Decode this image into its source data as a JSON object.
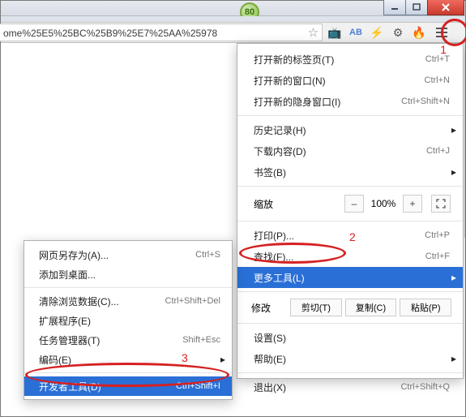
{
  "badge": "80",
  "url": "ome%25E5%25BC%25B9%25E7%25AA%25978",
  "main_menu": {
    "new_tab": "打开新的标签页(T)",
    "new_tab_sc": "Ctrl+T",
    "new_window": "打开新的窗口(N)",
    "new_window_sc": "Ctrl+N",
    "incognito": "打开新的隐身窗口(I)",
    "incognito_sc": "Ctrl+Shift+N",
    "history": "历史记录(H)",
    "downloads": "下载内容(D)",
    "downloads_sc": "Ctrl+J",
    "bookmarks": "书签(B)",
    "zoom_label": "缩放",
    "zoom_pct": "100%",
    "print": "打印(P)...",
    "print_sc": "Ctrl+P",
    "find": "查找(F)...",
    "find_sc": "Ctrl+F",
    "more_tools": "更多工具(L)",
    "edit_label": "修改",
    "cut": "剪切(T)",
    "copy": "复制(C)",
    "paste": "粘贴(P)",
    "settings": "设置(S)",
    "help": "帮助(E)",
    "exit": "退出(X)",
    "exit_sc": "Ctrl+Shift+Q"
  },
  "sub_menu": {
    "save_as": "网页另存为(A)...",
    "save_as_sc": "Ctrl+S",
    "add_desktop": "添加到桌面...",
    "clear_data": "清除浏览数据(C)...",
    "clear_data_sc": "Ctrl+Shift+Del",
    "extensions": "扩展程序(E)",
    "task_mgr": "任务管理器(T)",
    "task_mgr_sc": "Shift+Esc",
    "encoding": "编码(E)",
    "dev_tools": "开发者工具(D)",
    "dev_tools_sc": "Ctrl+Shift+I"
  },
  "ann": {
    "n1": "1",
    "n2": "2",
    "n3": "3"
  }
}
